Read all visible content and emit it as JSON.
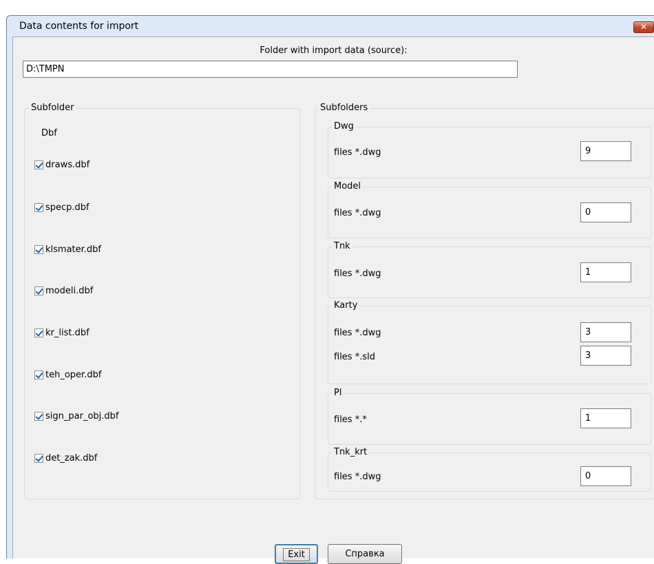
{
  "window": {
    "title": "Data contents for import",
    "close_glyph": "✕"
  },
  "source": {
    "label": "Folder with import data (source):",
    "path": "D:\\TMPN"
  },
  "left_group": {
    "legend": "Subfolder",
    "heading": "Dbf",
    "files": [
      {
        "name": "draws.dbf",
        "checked": true
      },
      {
        "name": "specp.dbf",
        "checked": true
      },
      {
        "name": "klsmater.dbf",
        "checked": true
      },
      {
        "name": "modeli.dbf",
        "checked": true
      },
      {
        "name": "kr_list.dbf",
        "checked": true
      },
      {
        "name": "teh_oper.dbf",
        "checked": true
      },
      {
        "name": "sign_par_obj.dbf",
        "checked": true
      },
      {
        "name": "det_zak.dbf",
        "checked": true
      }
    ]
  },
  "right_group": {
    "legend": "Subfolders",
    "groups": [
      {
        "name": "Dwg",
        "rows": [
          {
            "label": "files *.dwg",
            "value": "9"
          }
        ]
      },
      {
        "name": "Model",
        "rows": [
          {
            "label": "files *.dwg",
            "value": "0"
          }
        ]
      },
      {
        "name": "Tnk",
        "rows": [
          {
            "label": "files *.dwg",
            "value": "1"
          }
        ]
      },
      {
        "name": "Karty",
        "rows": [
          {
            "label": "files *.dwg",
            "value": "3"
          },
          {
            "label": "files *.sld",
            "value": "3"
          }
        ]
      },
      {
        "name": "Pl",
        "rows": [
          {
            "label": "files *.*",
            "value": "1"
          }
        ]
      },
      {
        "name": "Tnk_krt",
        "rows": [
          {
            "label": "files *.dwg",
            "value": "0"
          }
        ]
      }
    ]
  },
  "buttons": {
    "exit": "Exit",
    "help": "Справка"
  }
}
